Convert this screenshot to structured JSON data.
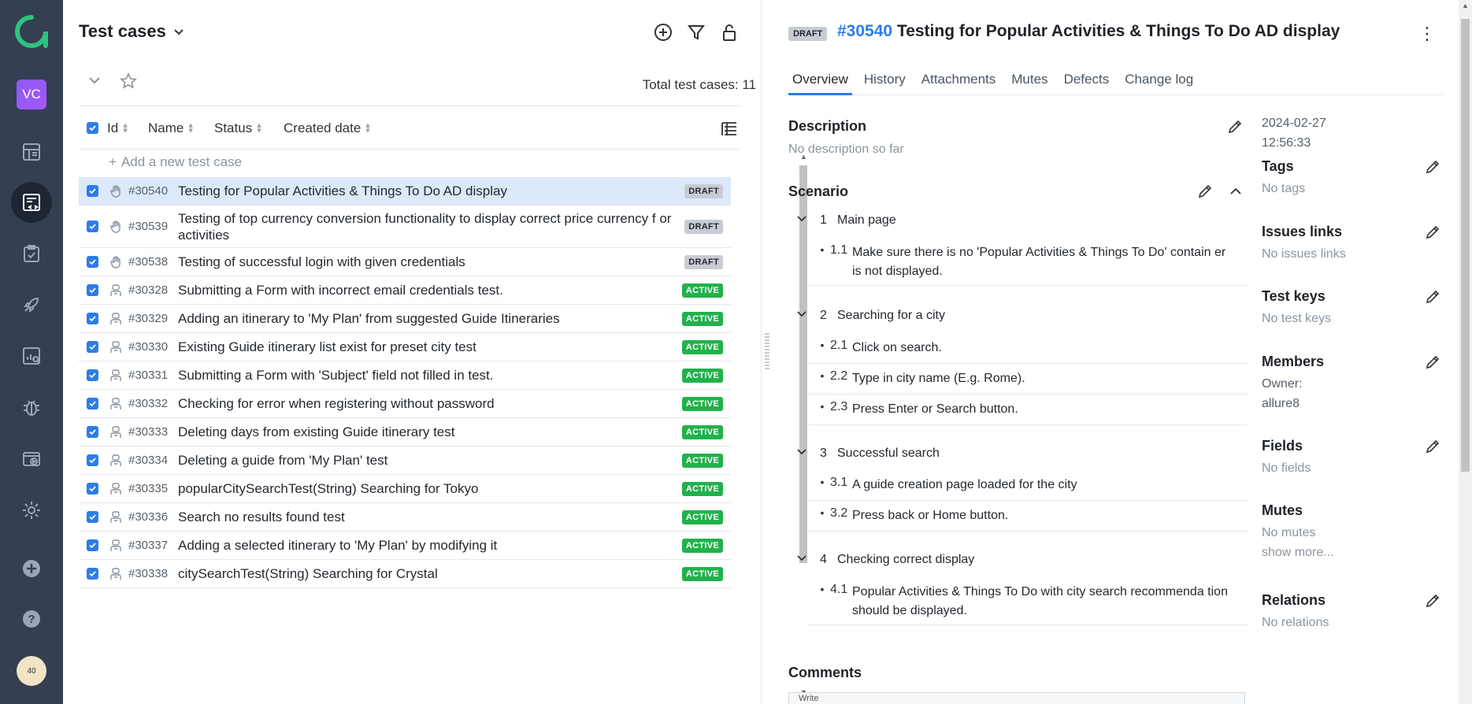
{
  "sidebar": {
    "avatar_initials": "VC",
    "user_badge": "40"
  },
  "list": {
    "title": "Test cases",
    "total_label": "Total test cases: 11",
    "columns": {
      "id": "Id",
      "name": "Name",
      "status": "Status",
      "created": "Created date"
    },
    "add_placeholder": "Add a new test case",
    "rows": [
      {
        "id": "#30540",
        "name": "Testing for Popular Activities & Things To Do AD display",
        "status": "DRAFT",
        "kind": "manual"
      },
      {
        "id": "#30539",
        "name": "Testing of top currency conversion functionality to display correct price currency f or activities",
        "status": "DRAFT",
        "kind": "manual"
      },
      {
        "id": "#30538",
        "name": "Testing of successful login with given credentials",
        "status": "DRAFT",
        "kind": "manual"
      },
      {
        "id": "#30328",
        "name": "Submitting a Form with incorrect email credentials test.",
        "status": "ACTIVE",
        "kind": "auto"
      },
      {
        "id": "#30329",
        "name": "Adding an itinerary to 'My Plan' from suggested Guide Itineraries",
        "status": "ACTIVE",
        "kind": "auto"
      },
      {
        "id": "#30330",
        "name": "Existing Guide itinerary list exist for preset city test",
        "status": "ACTIVE",
        "kind": "auto"
      },
      {
        "id": "#30331",
        "name": "Submitting a Form with 'Subject' field not filled in test.",
        "status": "ACTIVE",
        "kind": "auto"
      },
      {
        "id": "#30332",
        "name": "Checking for error when registering without password",
        "status": "ACTIVE",
        "kind": "auto"
      },
      {
        "id": "#30333",
        "name": "Deleting days from existing Guide itinerary test",
        "status": "ACTIVE",
        "kind": "auto"
      },
      {
        "id": "#30334",
        "name": "Deleting a guide from 'My Plan' test",
        "status": "ACTIVE",
        "kind": "auto"
      },
      {
        "id": "#30335",
        "name": "popularCitySearchTest(String) Searching for Tokyo",
        "status": "ACTIVE",
        "kind": "auto"
      },
      {
        "id": "#30336",
        "name": "Search no results found test",
        "status": "ACTIVE",
        "kind": "auto"
      },
      {
        "id": "#30337",
        "name": "Adding a selected itinerary to 'My Plan' by modifying it",
        "status": "ACTIVE",
        "kind": "auto"
      },
      {
        "id": "#30338",
        "name": "citySearchTest(String) Searching for Crystal",
        "status": "ACTIVE",
        "kind": "auto"
      }
    ]
  },
  "detail": {
    "status": "DRAFT",
    "id": "#30540",
    "title": "Testing for Popular Activities & Things To Do AD display",
    "tabs": [
      "Overview",
      "History",
      "Attachments",
      "Mutes",
      "Defects",
      "Change log"
    ],
    "description_label": "Description",
    "description_empty": "No description so far",
    "scenario_label": "Scenario",
    "steps": [
      {
        "num": "1",
        "title": "Main page",
        "subs": [
          {
            "num": "1.1",
            "text": "Make sure there is no 'Popular Activities & Things To Do' contain er is not displayed."
          }
        ]
      },
      {
        "num": "2",
        "title": "Searching for a city",
        "subs": [
          {
            "num": "2.1",
            "text": "Click on search."
          },
          {
            "num": "2.2",
            "text": "Type in city name (E.g. Rome)."
          },
          {
            "num": "2.3",
            "text": "Press Enter or Search button."
          }
        ]
      },
      {
        "num": "3",
        "title": "Successful search",
        "subs": [
          {
            "num": "3.1",
            "text": "A guide creation page loaded for the city"
          },
          {
            "num": "3.2",
            "text": "Press back or Home button."
          }
        ]
      },
      {
        "num": "4",
        "title": "Checking correct display",
        "subs": [
          {
            "num": "4.1",
            "text": "Popular Activities & Things To Do with city search recommenda tion should be displayed."
          }
        ]
      }
    ],
    "comments_label": "Comments",
    "comment_tab": "Write",
    "meta": {
      "date": "2024-02-27",
      "time": "12:56:33",
      "tags_label": "Tags",
      "tags_empty": "No tags",
      "issues_label": "Issues links",
      "issues_empty": "No issues links",
      "keys_label": "Test keys",
      "keys_empty": "No test keys",
      "members_label": "Members",
      "owner_label": "Owner:",
      "owner": "allure8",
      "fields_label": "Fields",
      "fields_empty": "No fields",
      "mutes_label": "Mutes",
      "mutes_empty": "No mutes",
      "show_more": "show more...",
      "relations_label": "Relations",
      "relations_empty": "No relations"
    }
  },
  "colors": {
    "accent": "#2b7de9",
    "sidebar": "#343f51",
    "active": "#22b14c",
    "draft": "#c7ccd3",
    "logo": "#2ec27e"
  }
}
